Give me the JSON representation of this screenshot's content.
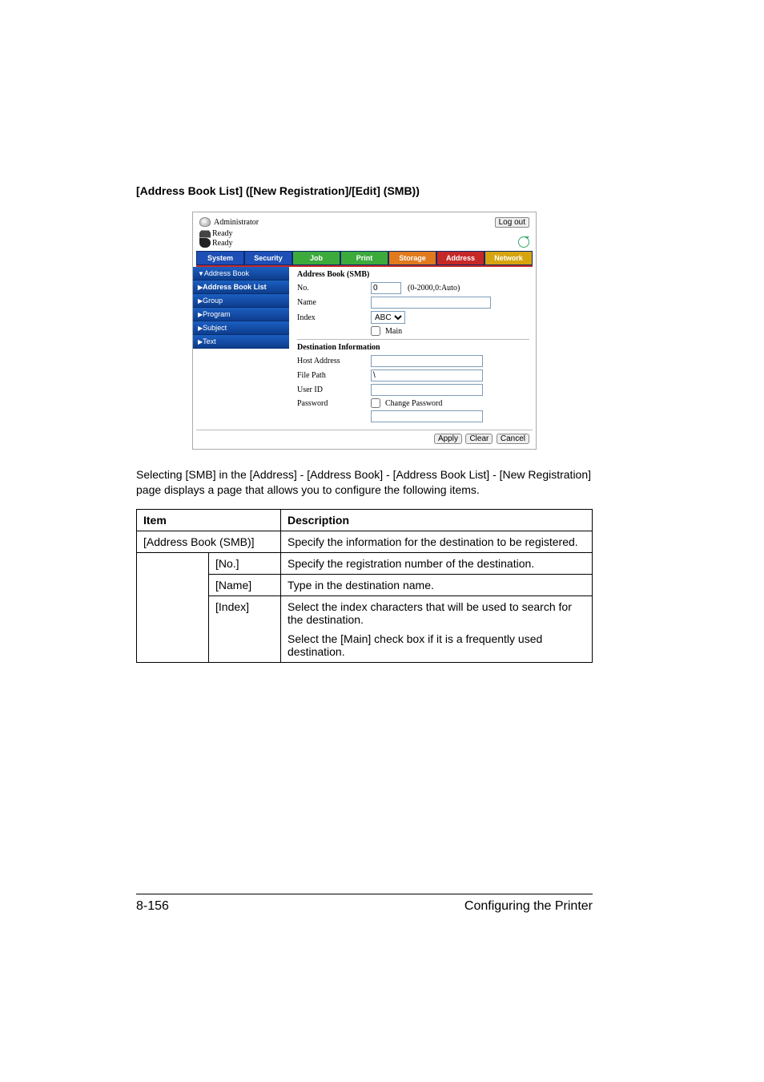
{
  "section_title": "[Address Book List] ([New Registration]/[Edit] (SMB))",
  "shot": {
    "user": "Administrator",
    "logout": "Log out",
    "status1": "Ready",
    "status2": "Ready",
    "tabs": {
      "system": "System",
      "security": "Security",
      "job": "Job",
      "print": "Print",
      "storage": "Storage",
      "address": "Address",
      "network": "Network"
    },
    "side": {
      "address_book": "Address Book",
      "address_book_list": "Address Book List",
      "group": "Group",
      "program": "Program",
      "subject": "Subject",
      "text": "Text"
    },
    "form": {
      "heading": "Address Book (SMB)",
      "no_label": "No.",
      "no_value": "0",
      "no_hint": "(0-2000,0:Auto)",
      "name_label": "Name",
      "index_label": "Index",
      "index_value": "ABC",
      "main_label": "Main",
      "dest_heading": "Destination Information",
      "host_label": "Host Address",
      "path_label": "File Path",
      "path_value": "\\",
      "user_label": "User ID",
      "pass_label": "Password",
      "change_pass": "Change Password"
    },
    "buttons": {
      "apply": "Apply",
      "clear": "Clear",
      "cancel": "Cancel"
    }
  },
  "paragraph": "Selecting [SMB] in the [Address] - [Address Book] - [Address Book List] - [New Registration] page displays a page that allows you to configure the following items.",
  "table": {
    "h_item": "Item",
    "h_desc": "Description",
    "r1_item": "[Address Book (SMB)]",
    "r1_desc": "Specify the information for the destination to be registered.",
    "r2_item": "[No.]",
    "r2_desc": "Specify the registration number of the destination.",
    "r3_item": "[Name]",
    "r3_desc": "Type in the destination name.",
    "r4_item": "[Index]",
    "r4_desc1": "Select the index characters that will be used to search for the destination.",
    "r4_desc2": "Select the [Main] check box if it is a frequently used destination."
  },
  "footer": {
    "page": "8-156",
    "chapter": "Configuring the Printer"
  }
}
